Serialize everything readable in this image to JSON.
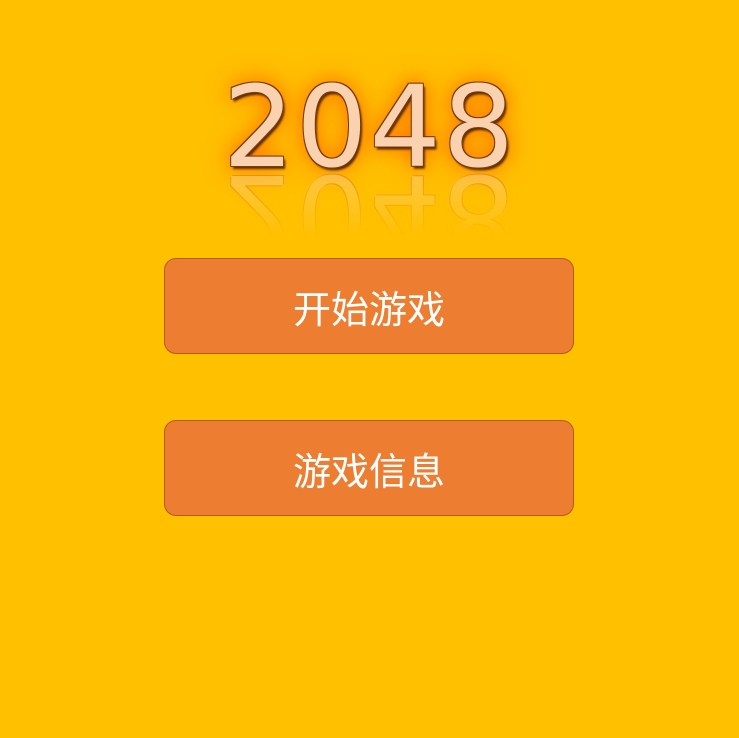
{
  "logo": {
    "title": "2048"
  },
  "menu": {
    "start_label": "开始游戏",
    "info_label": "游戏信息"
  },
  "colors": {
    "background": "#ffc000",
    "button": "#ed7d31",
    "button_text": "#ffffff",
    "logo_fill": "#fbd2b0",
    "logo_glow": "#ff6a00"
  }
}
